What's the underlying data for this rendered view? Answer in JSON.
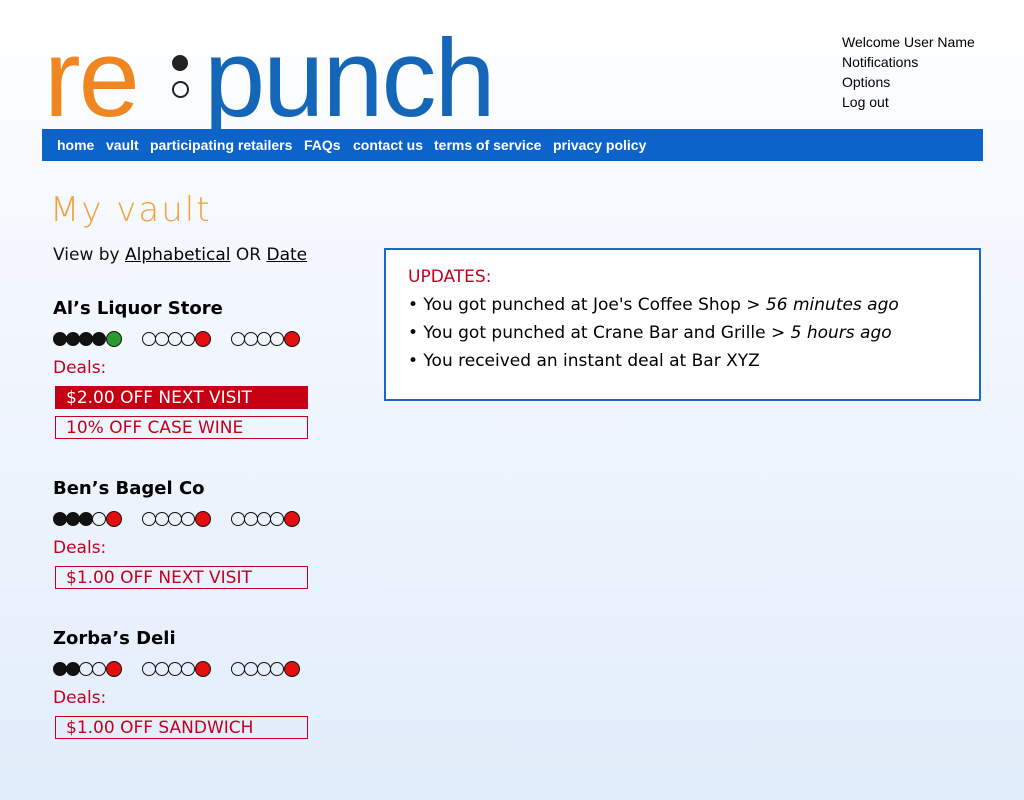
{
  "logo": {
    "part1": "re",
    "part2": "punch"
  },
  "user_menu": {
    "welcome": "Welcome User Name",
    "notifications": "Notifications",
    "options": "Options",
    "logout": "Log out"
  },
  "nav": {
    "items": [
      "home",
      "vault",
      "participating retailers",
      "FAQs",
      "contact us",
      "terms of service",
      "privacy policy"
    ]
  },
  "page_title": "My vault",
  "view_by": {
    "prefix": "View by",
    "alpha": "Alphabetical",
    "or": "OR",
    "date": "Date"
  },
  "stores": [
    {
      "name": "Al’s Liquor Store",
      "deals_label": "Deals:",
      "punches": {
        "filled": 4,
        "current": "green"
      },
      "deals": [
        {
          "text": "$2.00 OFF NEXT VISIT",
          "active": true
        },
        {
          "text": "10% OFF CASE WINE",
          "active": false
        }
      ]
    },
    {
      "name": "Ben’s Bagel Co",
      "deals_label": "Deals:",
      "punches": {
        "filled": 3,
        "current": "red"
      },
      "deals": [
        {
          "text": "$1.00 OFF NEXT VISIT",
          "active": false
        }
      ]
    },
    {
      "name": "Zorba’s Deli",
      "deals_label": "Deals:",
      "punches": {
        "filled": 2,
        "current": "red"
      },
      "deals": [
        {
          "text": "$1.00 OFF SANDWICH",
          "active": false
        }
      ]
    }
  ],
  "updates": {
    "title": "UPDATES:",
    "items": [
      {
        "text": "• You got punched at Joe's Coffee Shop ",
        "time": "> 56 minutes ago"
      },
      {
        "text": "• You got punched at Crane Bar and Grille ",
        "time": "> 5 hours ago"
      },
      {
        "text": "• You received an instant deal at Bar XYZ",
        "time": ""
      }
    ]
  },
  "colors": {
    "nav_blue": "#0c63c9",
    "deal_red": "#c3001e",
    "logo_orange": "#f0861f",
    "logo_blue": "#1466b8"
  }
}
